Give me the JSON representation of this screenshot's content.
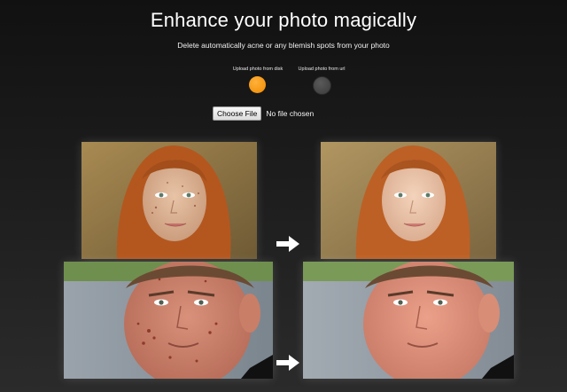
{
  "header": {
    "title": "Enhance your photo magically",
    "subtitle": "Delete automatically acne or any blemish spots from your photo"
  },
  "upload": {
    "options": [
      {
        "label": "Upload photo from disk",
        "selected": true
      },
      {
        "label": "Upload photo from url",
        "selected": false
      }
    ],
    "choose_label": "Choose File",
    "status": "No file chosen"
  },
  "colors": {
    "accent": "#f7a21b",
    "inactive": "#444444",
    "background": "#1c1c1c"
  },
  "examples": [
    {
      "name": "woman",
      "before": "woman-before-photo",
      "after": "woman-after-photo"
    },
    {
      "name": "man",
      "before": "man-before-photo",
      "after": "man-after-photo"
    }
  ]
}
